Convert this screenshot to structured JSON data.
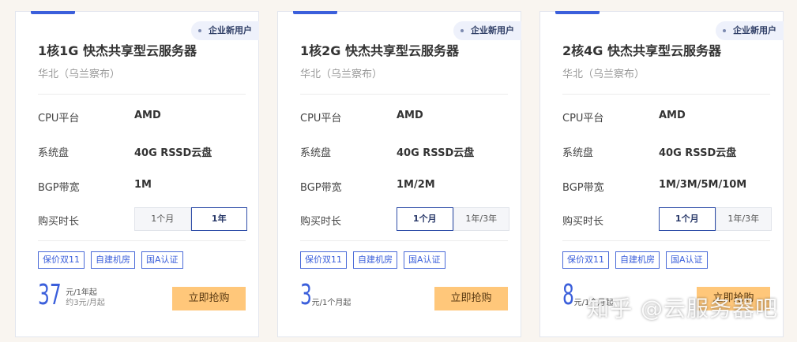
{
  "badge_label": "企业新用户",
  "spec_labels": {
    "cpu": "CPU平台",
    "disk": "系统盘",
    "bandwidth": "BGP带宽",
    "duration": "购买时长"
  },
  "tags": [
    "保价双11",
    "自建机房",
    "国A认证"
  ],
  "buy_label": "立即抢购",
  "watermark": "知乎 @云服务器吧",
  "colors": {
    "accent": "#3b5fdb",
    "buy_button": "#ffc77a",
    "badge_bg": "#eef1fb",
    "background": "#f9f5f0"
  },
  "cards": [
    {
      "title": "1核1G 快杰共享型云服务器",
      "region": "华北（乌兰察布）",
      "cpu": "AMD",
      "disk": "40G RSSD云盘",
      "bandwidth": "1M",
      "durations": [
        {
          "label": "1个月",
          "selected": false
        },
        {
          "label": "1年",
          "selected": true
        }
      ],
      "price": "37",
      "price_unit": "元/1年起",
      "price_sub": "约3元/月起"
    },
    {
      "title": "1核2G 快杰共享型云服务器",
      "region": "华北（乌兰察布）",
      "cpu": "AMD",
      "disk": "40G RSSD云盘",
      "bandwidth": "1M/2M",
      "durations": [
        {
          "label": "1个月",
          "selected": true
        },
        {
          "label": "1年/3年",
          "selected": false
        }
      ],
      "price": "3",
      "price_unit": "元/1个月起",
      "price_sub": ""
    },
    {
      "title": "2核4G 快杰共享型云服务器",
      "region": "华北（乌兰察布）",
      "cpu": "AMD",
      "disk": "40G RSSD云盘",
      "bandwidth": "1M/3M/5M/10M",
      "durations": [
        {
          "label": "1个月",
          "selected": true
        },
        {
          "label": "1年/3年",
          "selected": false
        }
      ],
      "price": "8",
      "price_unit": "元/1个月起",
      "price_sub": ""
    }
  ]
}
